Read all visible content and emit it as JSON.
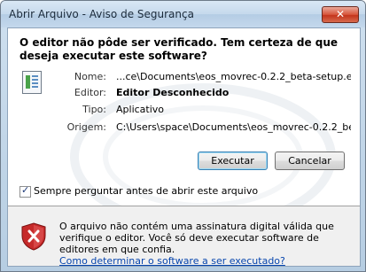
{
  "window": {
    "title": "Abrir Arquivo - Aviso de Segurança",
    "close_icon": "close-icon"
  },
  "dialog": {
    "heading": "O editor não pôde ser verificado.  Tem certeza de que deseja executar este software?",
    "icon": "installer-file-icon",
    "fields": [
      {
        "label": "Nome:",
        "value": "...ce\\Documents\\eos_movrec-0.2.2_beta-setup.exe",
        "bold": false
      },
      {
        "label": "Editor:",
        "value": "Editor Desconhecido",
        "bold": true
      },
      {
        "label": "Tipo:",
        "value": "Aplicativo",
        "bold": false
      },
      {
        "label": "Origem:",
        "value": "C:\\Users\\space\\Documents\\eos_movrec-0.2.2_bet...",
        "bold": false
      }
    ],
    "buttons": {
      "execute": "Executar",
      "cancel": "Cancelar"
    },
    "checkbox": {
      "label": "Sempre perguntar antes de abrir este arquivo",
      "checked": true
    }
  },
  "footer": {
    "icon": "security-shield-icon",
    "text": "O arquivo não contém uma assinatura digital válida que verifique o editor. Você só deve executar software de editores em que confia.",
    "link": "Como determinar o software a ser executado?"
  }
}
